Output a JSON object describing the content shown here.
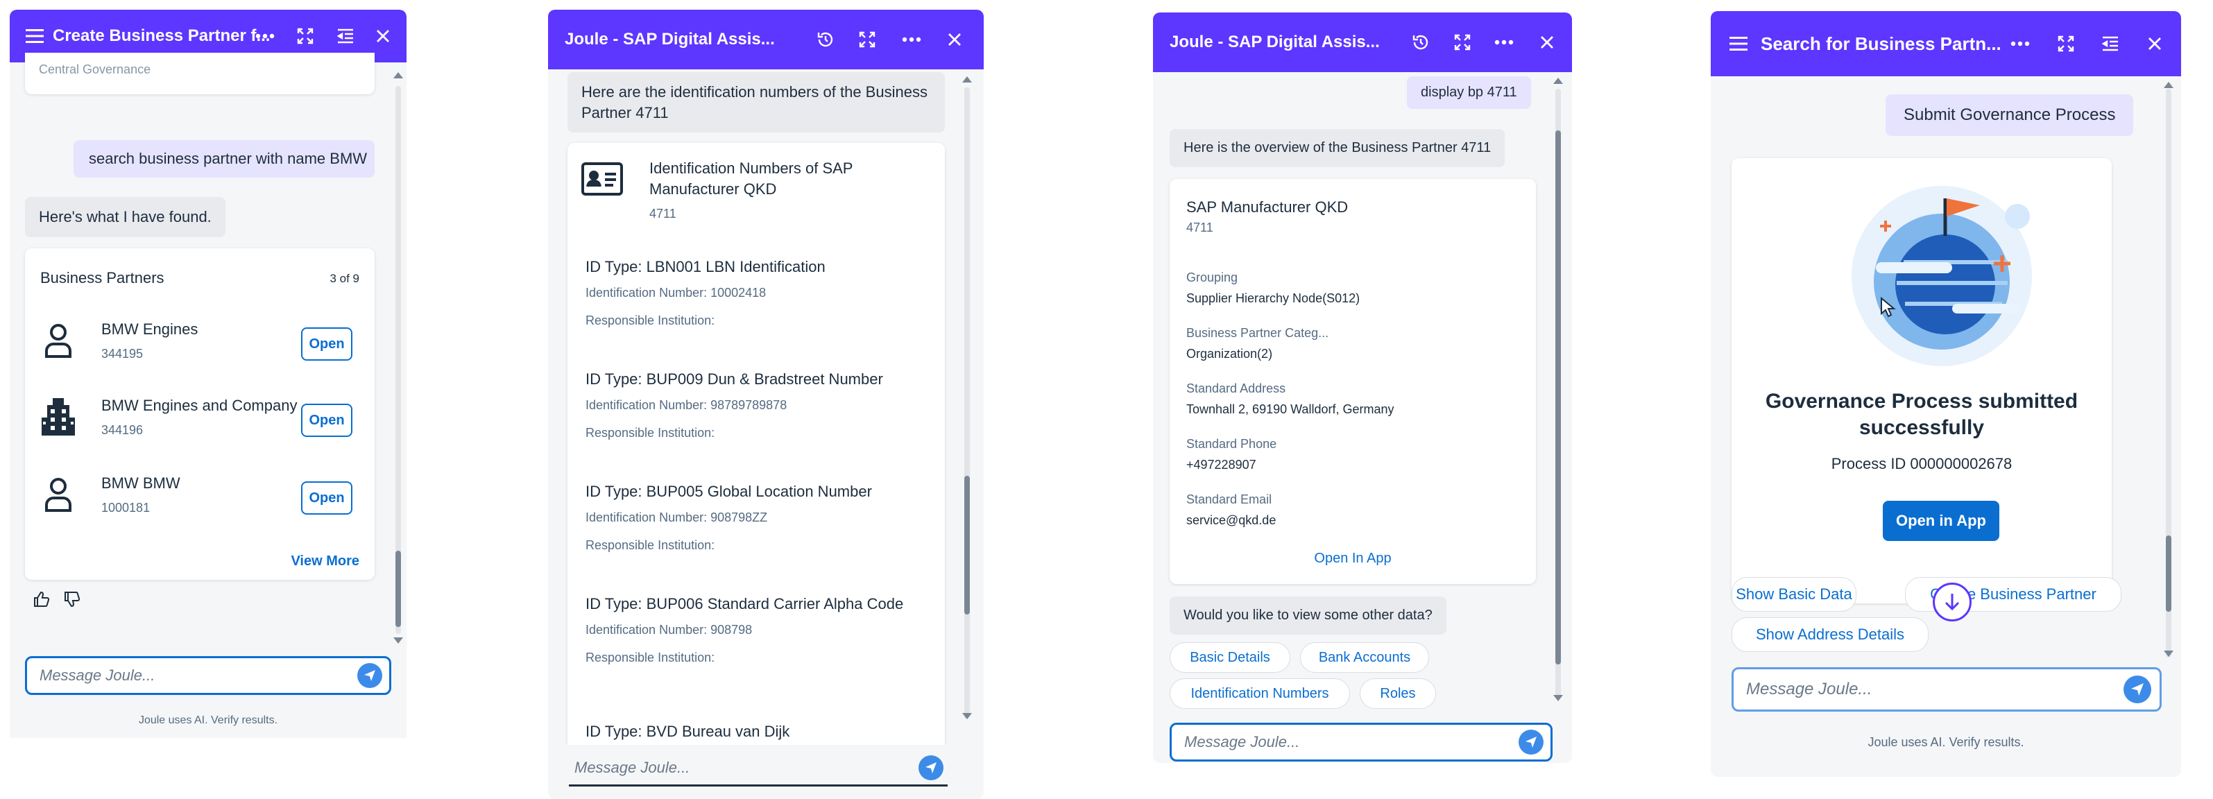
{
  "colors": {
    "header": "#5d36ff",
    "link": "#0a6ed1",
    "user_bubble": "#e6e3ff",
    "bot_bubble": "#e9eaee"
  },
  "panel1": {
    "title": "Create Business Partner f...",
    "partial_text": "Central Governance",
    "user_message": "search business partner with name BMW",
    "bot_message": "Here's what I have found.",
    "card_title": "Business Partners",
    "card_count": "3 of 9",
    "items": [
      {
        "name": "BMW Engines",
        "id": "344195",
        "icon": "person-icon",
        "button": "Open"
      },
      {
        "name": "BMW Engines and Company",
        "id": "344196",
        "icon": "building-icon",
        "button": "Open"
      },
      {
        "name": "BMW BMW",
        "id": "1000181",
        "icon": "person-icon",
        "button": "Open"
      }
    ],
    "view_more": "View More",
    "input_placeholder": "Message Joule...",
    "footer": "Joule uses AI. Verify results."
  },
  "panel2": {
    "title": "Joule - SAP Digital Assis...",
    "bot_message_line1": "Here are the identification numbers of the Business",
    "bot_message_line2": "Partner 4711",
    "card_title_line1": "Identification Numbers of SAP",
    "card_title_line2": "Manufacturer QKD",
    "card_subtitle": "4711",
    "id_types": [
      {
        "type": "ID Type: LBN001 LBN Identification",
        "number": "Identification Number: 10002418",
        "institution": "Responsible Institution:"
      },
      {
        "type": "ID Type: BUP009 Dun & Bradstreet Number",
        "number": "Identification Number: 98789789878",
        "institution": "Responsible Institution:"
      },
      {
        "type": "ID Type: BUP005 Global Location Number",
        "number": "Identification Number: 908798ZZ",
        "institution": "Responsible Institution:"
      },
      {
        "type": "ID Type: BUP006 Standard Carrier Alpha Code",
        "number": "Identification Number: 908798",
        "institution": "Responsible Institution:"
      }
    ],
    "partial_last": "ID Type: BVD Bureau van Dijk",
    "input_placeholder": "Message Joule..."
  },
  "panel3": {
    "title": "Joule - SAP Digital Assis...",
    "user_message": "display bp 4711",
    "bot_message": "Here is the overview of the Business Partner 4711",
    "card_title": "SAP Manufacturer QKD",
    "card_subtitle": "4711",
    "fields": [
      {
        "label": "Grouping",
        "value": "Supplier Hierarchy Node(S012)"
      },
      {
        "label": "Business Partner Categ...",
        "value": "Organization(2)"
      },
      {
        "label": "Standard Address",
        "value": "Townhall 2, 69190 Walldorf, Germany"
      },
      {
        "label": "Standard Phone",
        "value": "+497228907"
      },
      {
        "label": "Standard Email",
        "value": "service@qkd.de"
      }
    ],
    "open_in_app": "Open In App",
    "bot_question": "Would you like to view some other data?",
    "chips": [
      "Basic Details",
      "Bank Accounts",
      "Identification Numbers",
      "Roles"
    ],
    "input_placeholder": "Message Joule..."
  },
  "panel4": {
    "title": "Search for Business Partn...",
    "user_message": "Submit Governance Process",
    "success_line1": "Governance Process submitted",
    "success_line2": "successfully",
    "process_id": "Process ID 000000002678",
    "open_button": "Open in App",
    "chips": [
      "Show Basic Data",
      "Create Business Partner",
      "Show Address Details"
    ],
    "input_placeholder": "Message Joule...",
    "footer": "Joule uses AI. Verify results."
  }
}
